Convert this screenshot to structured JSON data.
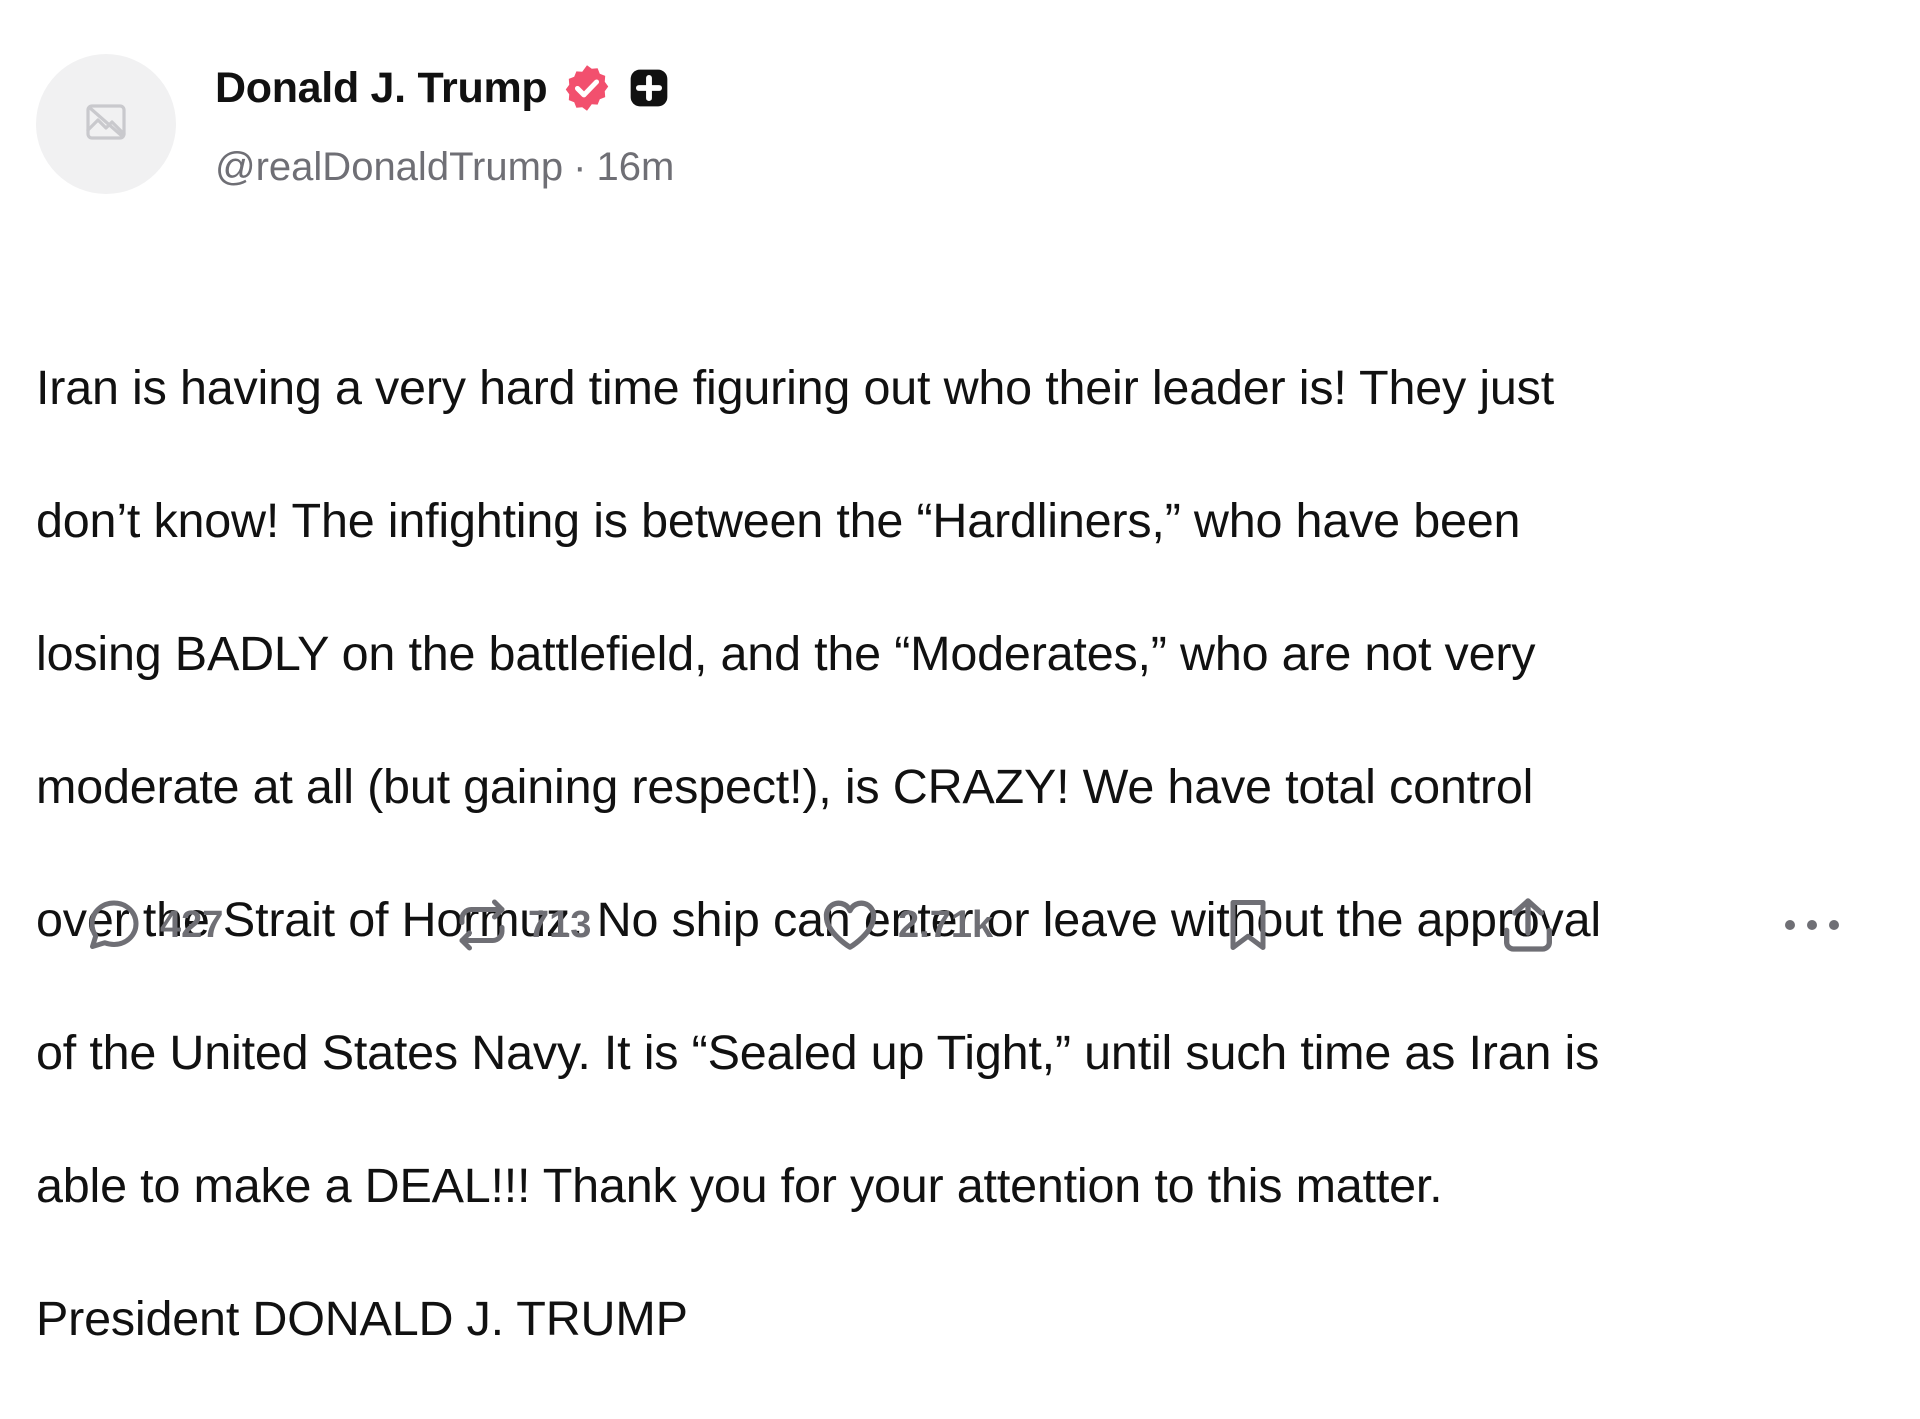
{
  "post": {
    "author": {
      "display_name": "Donald J. Trump",
      "handle": "@realDonaldTrump",
      "verified": true,
      "avatar_icon": "broken-image-icon"
    },
    "separator": "·",
    "time_ago": "16m",
    "body_lines": [
      "Iran is having a very hard time figuring out who their leader is! They just",
      "don’t know! The infighting is between the “Hardliners,” who have been",
      "losing BADLY on the battlefield, and the “Moderates,” who are not very",
      "moderate at all (but gaining respect!), is CRAZY! We have total control",
      "over the Strait of Hormuz. No ship can enter or leave without the approval",
      "of the United States Navy. It is “Sealed up Tight,” until such time as Iran is",
      "able to make a DEAL!!! Thank you for your attention to this matter.",
      "President DONALD J. TRUMP"
    ],
    "actions": {
      "replies": "427",
      "reposts": "713",
      "likes": "2.71k"
    }
  },
  "colors": {
    "verified_badge": "#f2506e",
    "text_primary": "#111111",
    "text_secondary": "#6f6f75",
    "avatar_bg": "#f1f1f2",
    "icon_gray": "#6f6f75"
  },
  "icons": {
    "verified": "verified-badge-icon",
    "plus": "plus-badge-icon",
    "reply": "speech-bubble-icon",
    "repost": "repost-arrows-icon",
    "like": "heart-icon",
    "bookmark": "bookmark-icon",
    "share": "share-upload-icon",
    "more": "more-dots-icon"
  }
}
